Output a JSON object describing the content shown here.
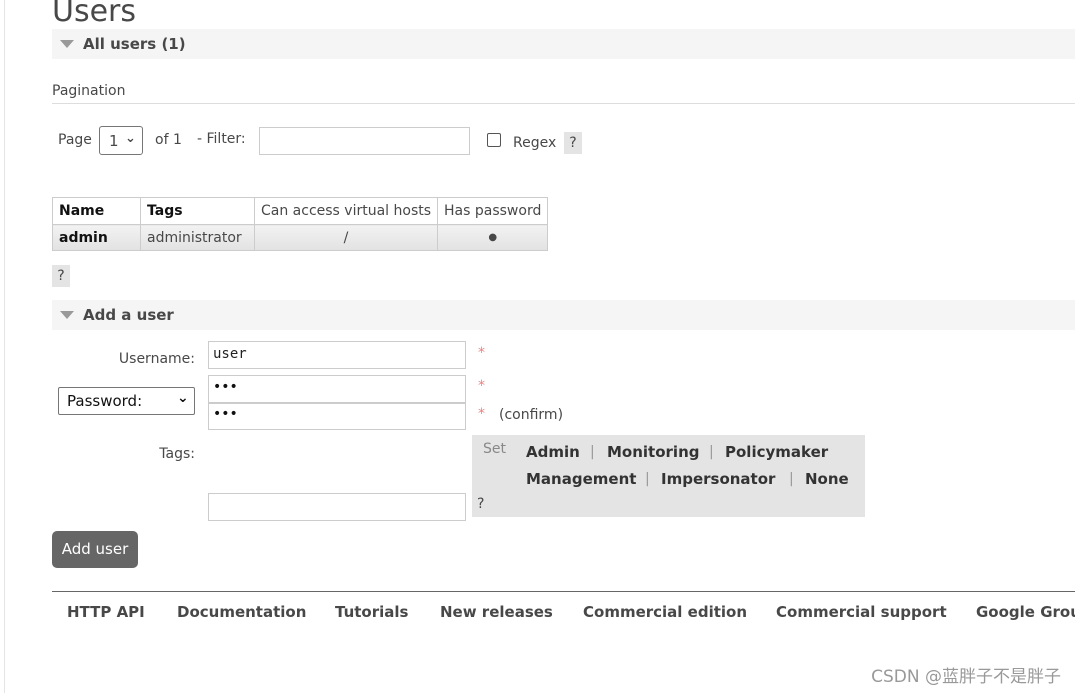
{
  "page": {
    "title": "Users"
  },
  "all_users": {
    "header": "All users (1)",
    "pagination_label": "Pagination",
    "page_label": "Page",
    "page_value": "1",
    "of_label": "of 1",
    "filter_label": "- Filter:",
    "filter_value": "",
    "regex_label": "Regex",
    "help": "?",
    "columns": [
      "Name",
      "Tags",
      "Can access virtual hosts",
      "Has password"
    ],
    "rows": [
      {
        "name": "admin",
        "tags": "administrator",
        "vhosts": "/",
        "has_password": "●"
      }
    ],
    "table_help": "?"
  },
  "add_user": {
    "header": "Add a user",
    "username_label": "Username:",
    "username_value": "user",
    "password_mode": "Password:",
    "password_value": "•••",
    "confirm_value": "•••",
    "required": "*",
    "confirm_label": "(confirm)",
    "tags_label": "Tags:",
    "tags_value": "",
    "set_label": "Set",
    "tag_options": [
      "Admin",
      "Monitoring",
      "Policymaker",
      "Management",
      "Impersonator",
      "None"
    ],
    "separator": "|",
    "tags_help": "?",
    "submit": "Add user"
  },
  "footer": {
    "links": [
      "HTTP API",
      "Documentation",
      "Tutorials",
      "New releases",
      "Commercial edition",
      "Commercial support",
      "Google Group"
    ]
  },
  "watermark": "CSDN @蓝胖子不是胖子"
}
